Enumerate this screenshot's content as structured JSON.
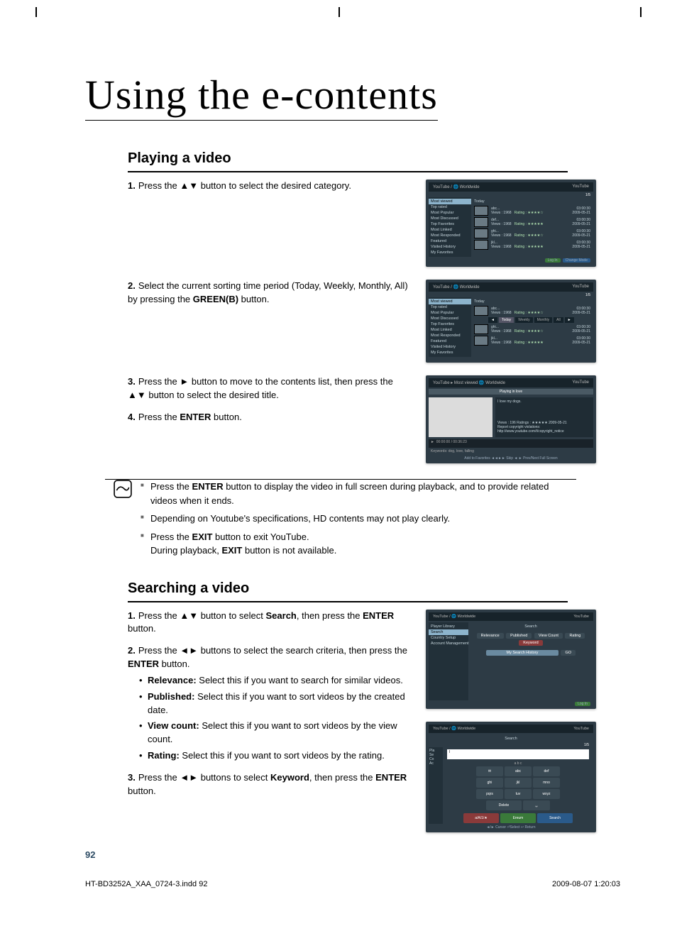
{
  "chapter_title": "Using the e-contents",
  "section_playing": "Playing a video",
  "section_searching": "Searching a video",
  "playing_steps": {
    "1": "Press the ▲▼ button to select the desired category.",
    "2_a": "Select the current sorting time period (Today, Weekly, Monthly, All) by pressing the ",
    "2_green": "GREEN(B)",
    "2_b": " button.",
    "3": "Press the ► button to move to the contents list, then press the ▲▼ button to select the desired title.",
    "4_a": "Press the ",
    "4_b": "ENTER",
    "4_c": " button."
  },
  "notes": {
    "n1_a": "Press the ",
    "n1_b": "ENTER",
    "n1_c": " button to display the video in full screen during playback, and to provide related videos when it ends.",
    "n2": "Depending on Youtube's specifications, HD contents may not play clearly.",
    "n3_a": "Press the ",
    "n3_b": "EXIT",
    "n3_c": " button to exit YouTube.",
    "n3_d": "During playback, ",
    "n3_e": "EXIT",
    "n3_f": " button is not available."
  },
  "searching_steps": {
    "1_a": "Press the ▲▼ button to select ",
    "1_b": "Search",
    "1_c": ", then press the ",
    "1_d": "ENTER",
    "1_e": " button.",
    "2_a": "Press the ◄► buttons to select the search criteria, then press the ",
    "2_b": "ENTER",
    "2_c": " button.",
    "b_rel_l": "Relevance:",
    "b_rel_t": " Select this if you want to search for similar videos.",
    "b_pub_l": "Published:",
    "b_pub_t": " Select this if you want to sort videos by the created date.",
    "b_vc_l": "View count:",
    "b_vc_t": " Select this if you want to sort videos by the view count.",
    "b_rat_l": "Rating:",
    "b_rat_t": " Select this if you want to sort videos by the rating.",
    "3_a": "Press the ◄► buttons to select ",
    "3_b": "Keyword",
    "3_c": ", then press the ",
    "3_d": "ENTER",
    "3_e": " button."
  },
  "ui_screens": {
    "header_path": "YouTube / 🌐 Worldwide",
    "you_logo": "YouTube",
    "counter": "1/5",
    "sidebar": [
      "Most viewed",
      "Top rated",
      "Most Popular",
      "Most Discussed",
      "Top Favorites",
      "Most Linked",
      "Most Responded",
      "Featured",
      "Visited History",
      "My Favorites"
    ],
    "sort_label": "Today",
    "sort_opts": [
      "Today",
      "Weekly",
      "Monthly",
      "All"
    ],
    "rows": [
      {
        "title": "abc...",
        "views": "Views : 1968",
        "rating": "Rating : ★★★★☆",
        "dur": "03:00:30",
        "date": "2009-05-21"
      },
      {
        "title": "def...",
        "views": "Views : 1968",
        "rating": "Rating : ★★★★★",
        "dur": "03:00:30",
        "date": "2009-05-21"
      },
      {
        "title": "ghi...",
        "views": "Views : 1968",
        "rating": "Rating : ★★★★☆",
        "dur": "03:00:30",
        "date": "2009-05-21"
      },
      {
        "title": "jkl...",
        "views": "Views : 1968",
        "rating": "Rating : ★★★★★",
        "dur": "03:00:30",
        "date": "2009-05-21"
      }
    ],
    "footer_login": "Log In",
    "footer_mode": "Change Mode",
    "playback": {
      "header": "YouTube ▸ Most viewed    🌐 Worldwide",
      "title_bar": "Playing in love",
      "side_title": "I love my dogs.",
      "views_line": "Views : 196    Ratings : ★★★★★    2009-05-21",
      "report": "Report copyright violations:",
      "url": "http://www.youtube.com/t/copyright_notice",
      "time": "00:00:00 / 00:36:23",
      "keywords": "Keywords: dog, love, falling",
      "foot": "Add to Favorites   ◄◄►► Skip   ◄ ► Prev/Next   Full Screen"
    },
    "search": {
      "sidebar": [
        "Player Library",
        "Search",
        "Country Setup",
        "Account Management"
      ],
      "title": "Search",
      "pills": [
        "Relevance",
        "Published",
        "View Count",
        "Rating",
        "Keyword"
      ],
      "history": "My Search History",
      "go": "GO",
      "foot": "Log In"
    },
    "keyboard": {
      "title": "Search",
      "input": "I",
      "abc": "a b c",
      "keys": [
        [
          "abc",
          "def"
        ],
        [
          "ghi",
          "jkl",
          "mno"
        ],
        [
          "pqrs",
          "tuv",
          "wxyz"
        ],
        [
          "Delete",
          "␣"
        ]
      ],
      "bottom": [
        "a/A/1/★",
        "Ereum",
        "Search"
      ],
      "foot": "◄/► Cursor  ⏎Select  ↩ Return"
    }
  },
  "page_number": "92",
  "footer_left": "HT-BD3252A_XAA_0724-3.indd   92",
  "footer_right": "2009-08-07   1:20:03"
}
